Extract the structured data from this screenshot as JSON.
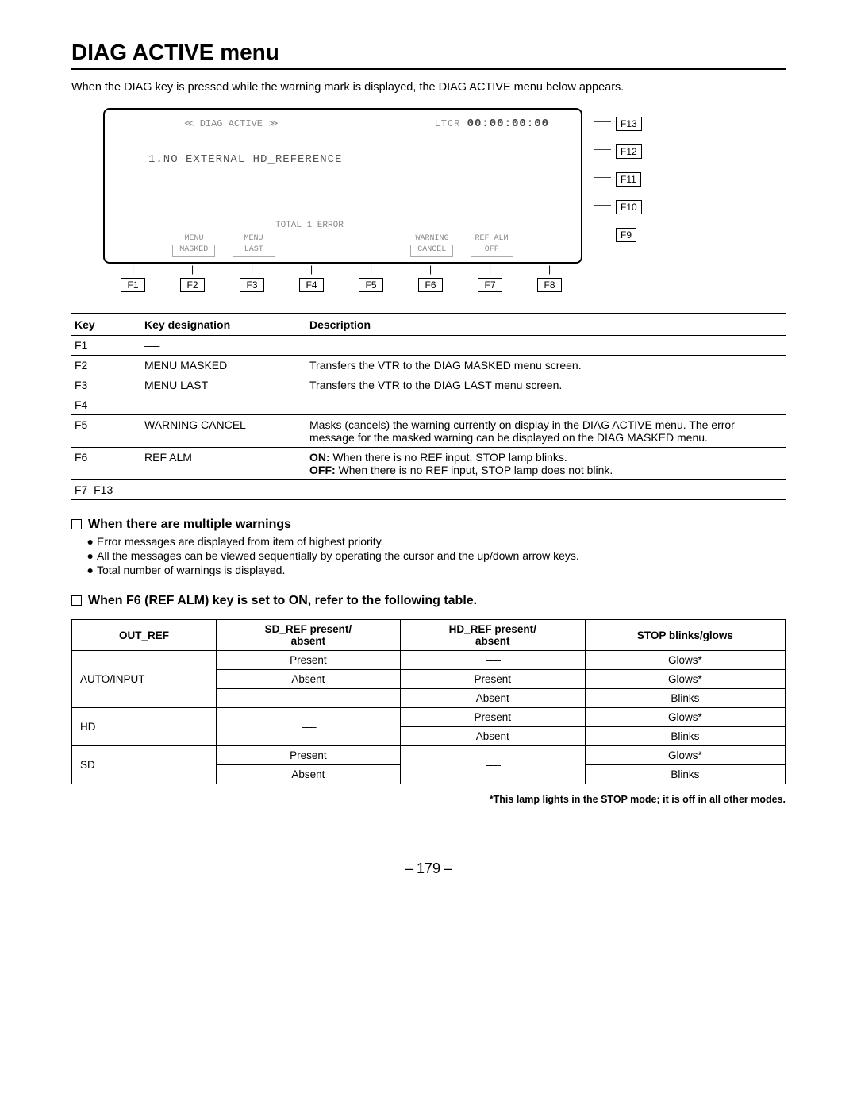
{
  "title": "DIAG ACTIVE menu",
  "intro": "When the DIAG key is pressed while the warning mark is displayed, the DIAG ACTIVE menu below appears.",
  "screen": {
    "header_title": "≪ DIAG ACTIVE ≫",
    "ltcr_label": "LTCR",
    "ltcr_value": "00:00:00:00",
    "message": "1.NO EXTERNAL HD_REFERENCE",
    "total": "TOTAL   1 ERROR",
    "soft_labels": [
      "",
      "MENU",
      "MENU",
      "",
      "",
      "WARNING",
      "REF ALM",
      ""
    ],
    "soft_buttons": [
      "",
      "MASKED",
      "LAST",
      "",
      "",
      "CANCEL",
      "OFF",
      ""
    ]
  },
  "bottom_fkeys": [
    "F1",
    "F2",
    "F3",
    "F4",
    "F5",
    "F6",
    "F7",
    "F8"
  ],
  "side_fkeys": [
    "F13",
    "F12",
    "F11",
    "F10",
    "F9"
  ],
  "key_table": {
    "headers": {
      "key": "Key",
      "designation": "Key designation",
      "description": "Description"
    },
    "rows": [
      {
        "key": "F1",
        "designation": "–––",
        "description": ""
      },
      {
        "key": "F2",
        "designation": "MENU MASKED",
        "description": "Transfers the VTR to the DIAG MASKED menu screen."
      },
      {
        "key": "F3",
        "designation": "MENU LAST",
        "description": "Transfers the VTR to the DIAG LAST menu screen."
      },
      {
        "key": "F4",
        "designation": "–––",
        "description": ""
      },
      {
        "key": "F5",
        "designation": "WARNING CANCEL",
        "description": "Masks (cancels) the warning currently on display in the DIAG ACTIVE menu. The error message for the masked warning can be displayed on the DIAG MASKED menu."
      },
      {
        "key": "F6",
        "designation": "REF ALM",
        "on_label": "ON:",
        "on_text": "When there is no REF input, STOP lamp blinks.",
        "off_label": "OFF:",
        "off_text": "When there is no REF input, STOP lamp does not blink."
      },
      {
        "key": "F7–F13",
        "designation": "–––",
        "description": ""
      }
    ]
  },
  "sections": {
    "multi_heading": "When there are multiple warnings",
    "multi_bullets": [
      "Error messages are displayed from item of highest priority.",
      "All the messages can be viewed sequentially by operating the cursor and the up/down arrow keys.",
      "Total number of warnings is displayed."
    ],
    "ref_heading": "When F6 (REF ALM) key is set to ON, refer to the following table."
  },
  "ref_table": {
    "headers": {
      "out_ref": "OUT_REF",
      "sd": "SD_REF present/\nabsent",
      "hd": "HD_REF present/\nabsent",
      "stop": "STOP blinks/glows"
    },
    "groups": [
      {
        "out_ref": "AUTO/INPUT",
        "rows": [
          {
            "sd": "Present",
            "hd": "–––",
            "stop": "Glows*"
          },
          {
            "sd": "Absent",
            "hd": "Present",
            "stop": "Glows*"
          },
          {
            "sd": "",
            "hd": "Absent",
            "stop": "Blinks"
          }
        ]
      },
      {
        "out_ref": "HD",
        "sd_merged": "–––",
        "rows": [
          {
            "hd": "Present",
            "stop": "Glows*"
          },
          {
            "hd": "Absent",
            "stop": "Blinks"
          }
        ]
      },
      {
        "out_ref": "SD",
        "hd_merged": "–––",
        "rows": [
          {
            "sd": "Present",
            "stop": "Glows*"
          },
          {
            "sd": "Absent",
            "stop": "Blinks"
          }
        ]
      }
    ]
  },
  "footnote": "*This lamp lights in the STOP mode;  it is off in all other modes.",
  "page_number": "– 179 –",
  "dash": "–––"
}
